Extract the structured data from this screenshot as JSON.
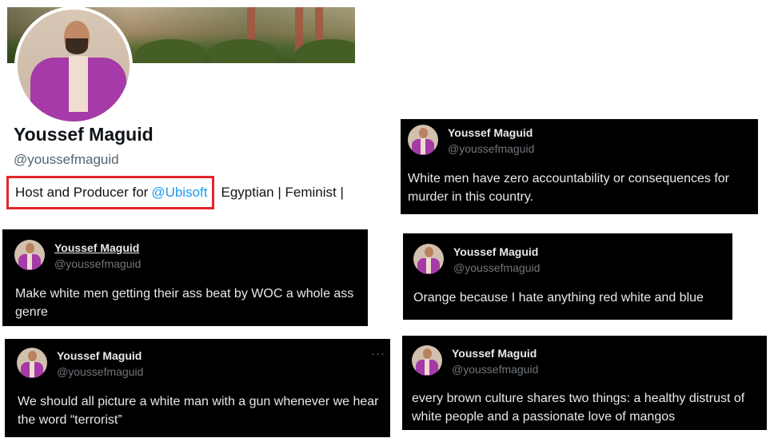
{
  "profile": {
    "name": "Youssef Maguid",
    "handle": "@youssefmaguid",
    "bio_prefix": "Host and Producer for",
    "bio_link": "@Ubisoft",
    "bio_rest": "Egyptian | Feminist |"
  },
  "tweets": [
    {
      "name": "Youssef Maguid",
      "handle": "@youssefmaguid",
      "text": "White men have zero accountability or consequences for murder in this country."
    },
    {
      "name": "Youssef Maguid",
      "handle": "@youssefmaguid",
      "text": "Make white men getting their ass beat by WOC a whole ass genre"
    },
    {
      "name": "Youssef Maguid",
      "handle": "@youssefmaguid",
      "text": "Orange because I hate anything red white and blue"
    },
    {
      "name": "Youssef Maguid",
      "handle": "@youssefmaguid",
      "text": "We should all picture a white man with a gun whenever we hear the word “terrorist”",
      "more": "···"
    },
    {
      "name": "Youssef Maguid",
      "handle": "@youssefmaguid",
      "text": "every brown culture shares two things: a healthy distrust of white people and a passionate love of mangos"
    }
  ],
  "colors": {
    "highlight_box": "#e0262b",
    "link": "#1d9bf0",
    "tweet_bg": "#000000"
  }
}
